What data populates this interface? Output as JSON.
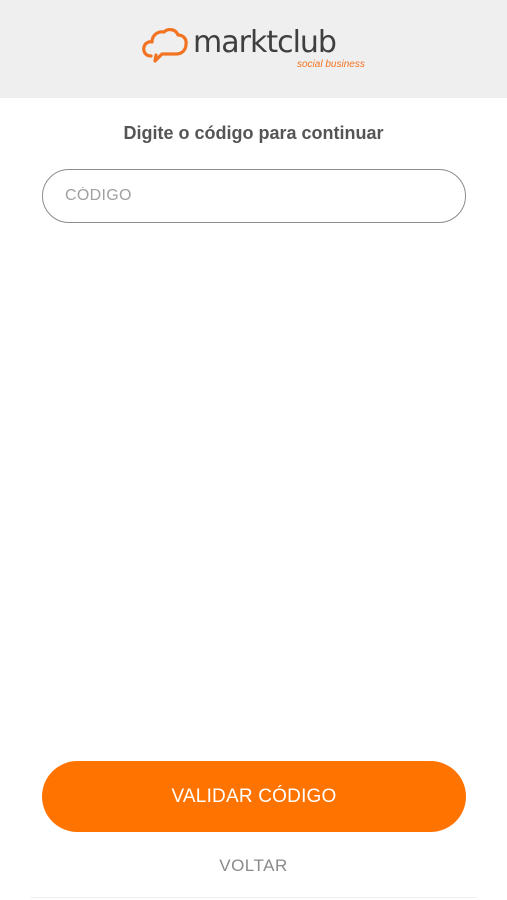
{
  "header": {
    "logo_word": "marktclub",
    "logo_tagline": "social business"
  },
  "form": {
    "prompt": "Digite o código para continuar",
    "code_input": {
      "value": "",
      "placeholder": "CÓDIGO"
    }
  },
  "actions": {
    "validate_label": "VALIDAR CÓDIGO",
    "back_label": "VOLTAR"
  },
  "colors": {
    "accent": "#ff7300",
    "header_background": "#efefef",
    "text": "#555555"
  }
}
